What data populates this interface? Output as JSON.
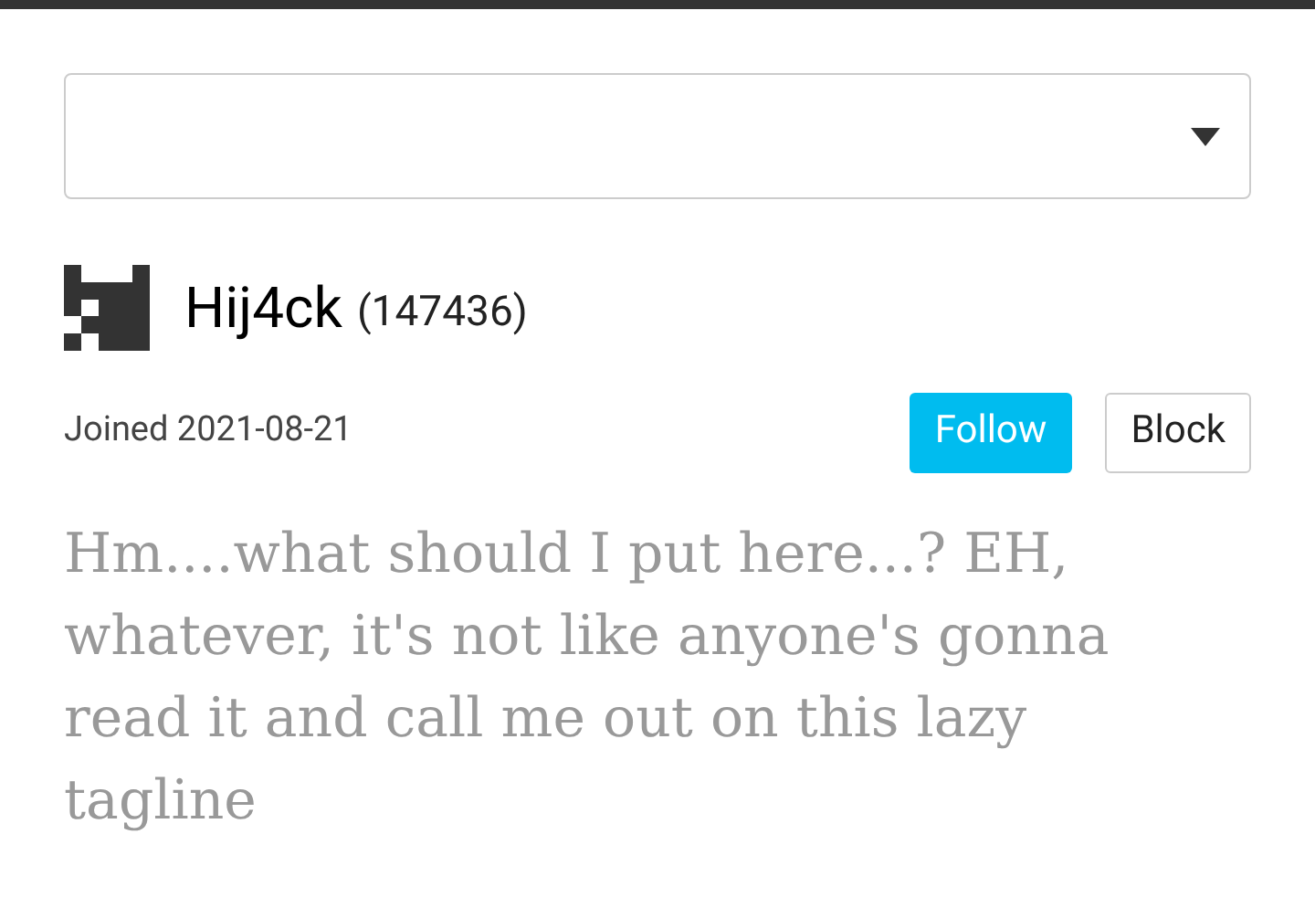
{
  "user": {
    "name": "Hij4ck",
    "points": "(147436)",
    "joined": "Joined 2021-08-21"
  },
  "buttons": [
    {
      "label": "Follow",
      "kind": "primary"
    },
    {
      "label": "Block",
      "kind": "secondary"
    }
  ],
  "tagline": "Hm....what should I put here...? EH, whatever, it's not like anyone's gonna read it and call me out on this lazy tagline"
}
